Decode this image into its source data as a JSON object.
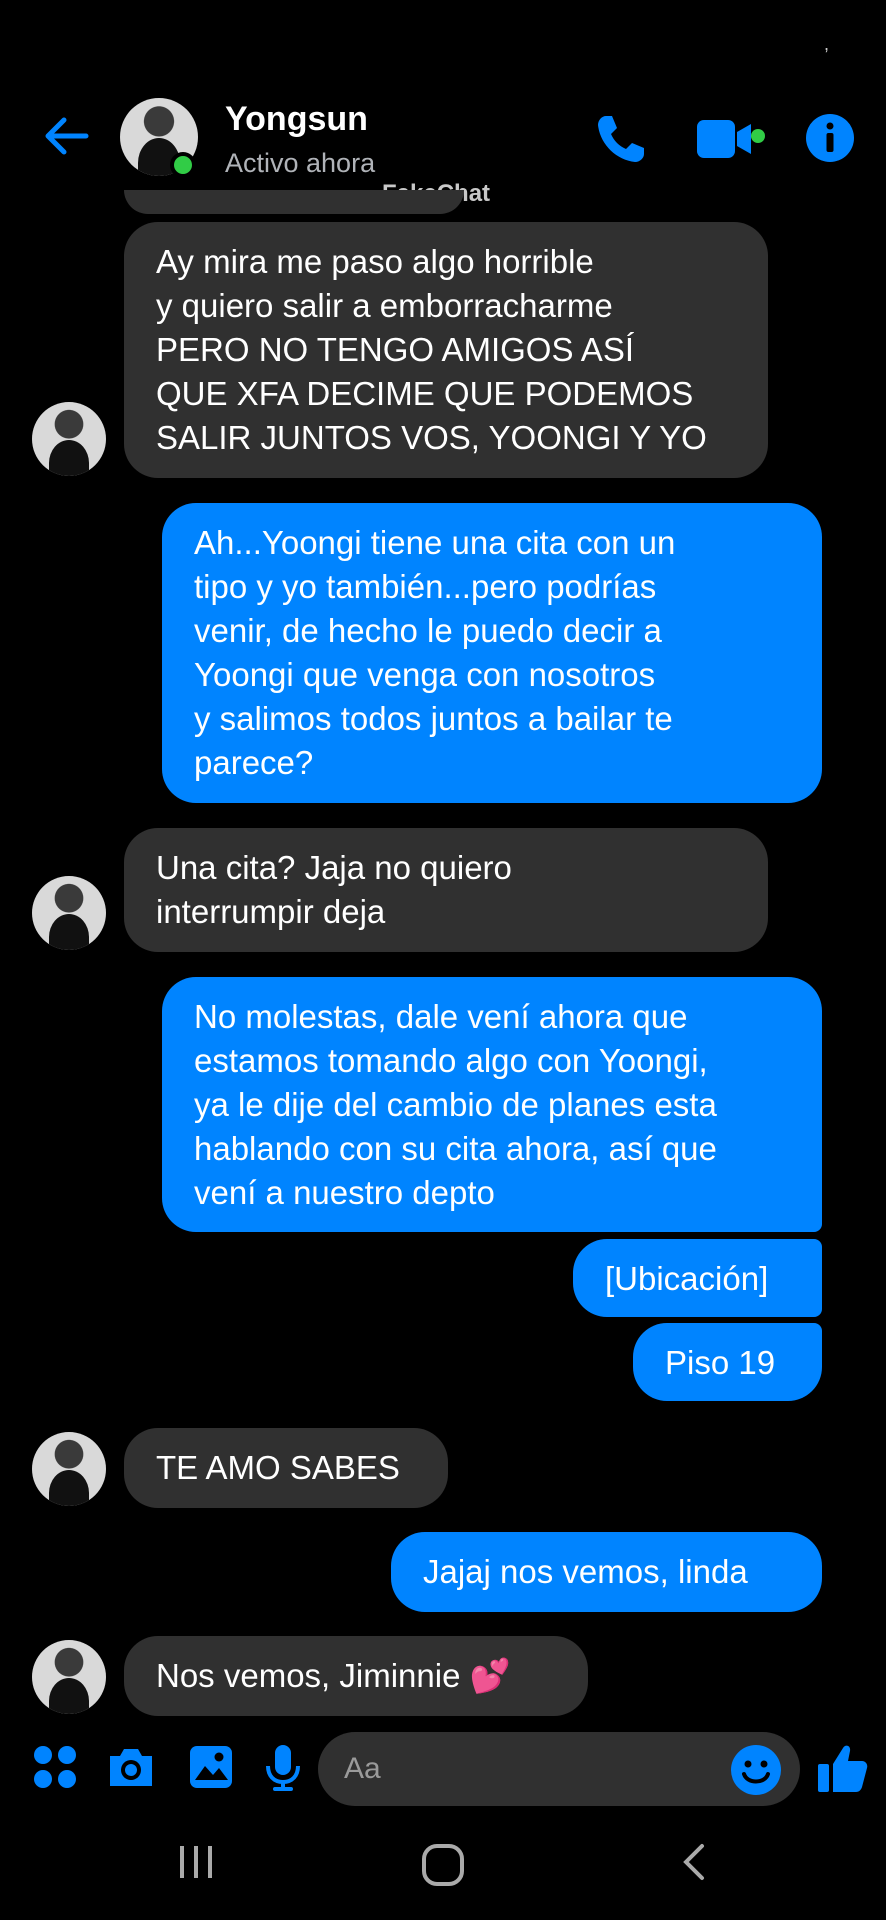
{
  "header": {
    "contact_name": "Yongsun",
    "status": "Activo ahora",
    "watermark": "FakeChat"
  },
  "messages": [
    {
      "from": "them",
      "text": "Ay mira me paso algo horrible\ny quiero salir a emborracharme\nPERO NO TENGO AMIGOS ASÍ\nQUE XFA DECIME QUE PODEMOS\nSALIR JUNTOS VOS, YOONGI Y YO"
    },
    {
      "from": "me",
      "text": "Ah...Yoongi tiene una cita con un\ntipo y yo también...pero podrías\nvenir, de hecho le puedo decir a\nYoongi que venga con nosotros\ny salimos todos juntos a bailar te\nparece?"
    },
    {
      "from": "them",
      "text": "Una cita? Jaja no quiero\ninterrumpir deja"
    },
    {
      "from": "me",
      "text": "No molestas, dale vení ahora que\nestamos tomando algo con Yoongi,\nya le dije del cambio de planes esta\nhablando con su cita ahora, así que\nvení a nuestro depto"
    },
    {
      "from": "me",
      "text": "[Ubicación]"
    },
    {
      "from": "me",
      "text": "Piso 19"
    },
    {
      "from": "them",
      "text": "TE AMO SABES"
    },
    {
      "from": "me",
      "text": "Jajaj nos vemos, linda"
    },
    {
      "from": "them",
      "text": "Nos vemos, Jiminnie 💕"
    }
  ],
  "composer": {
    "placeholder": "Aa"
  },
  "colors": {
    "accent": "#0084ff",
    "incoming_bubble": "#303030",
    "background": "#000000",
    "online": "#31cc46"
  },
  "icons": [
    "back-arrow-icon",
    "phone-icon",
    "video-camera-icon",
    "info-icon",
    "apps-grid-icon",
    "camera-icon",
    "gallery-icon",
    "microphone-icon",
    "emoji-icon",
    "thumbs-up-icon",
    "recent-apps-icon",
    "home-icon",
    "back-nav-icon"
  ]
}
